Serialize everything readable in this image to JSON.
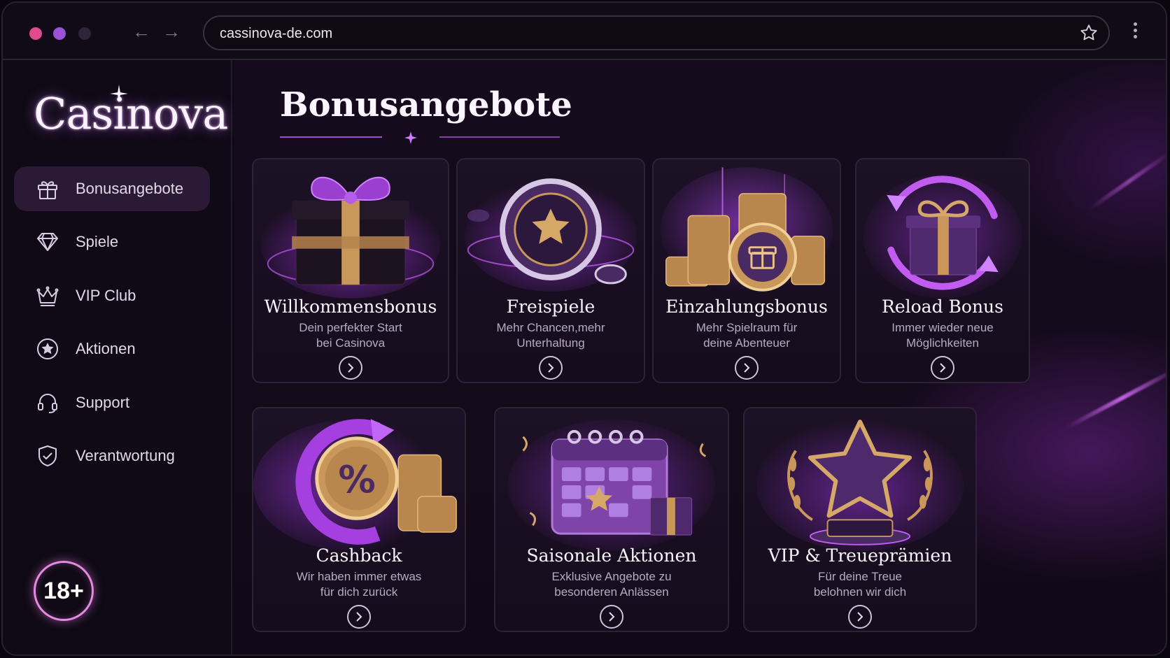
{
  "browser": {
    "url": "cassinova-de.com"
  },
  "sidebar": {
    "logo": "Casinova",
    "items": [
      {
        "label": "Bonusangebote",
        "icon": "gift-icon",
        "active": true
      },
      {
        "label": "Spiele",
        "icon": "diamond-icon",
        "active": false
      },
      {
        "label": "VIP Club",
        "icon": "crown-icon",
        "active": false
      },
      {
        "label": "Aktionen",
        "icon": "star-circle-icon",
        "active": false
      },
      {
        "label": "Support",
        "icon": "headset-icon",
        "active": false
      },
      {
        "label": "Verantwortung",
        "icon": "shield-check-icon",
        "active": false
      }
    ],
    "age_badge": "18+"
  },
  "main": {
    "title": "Bonusangebote",
    "cards": [
      {
        "title": "Willkommensbonus",
        "desc1": "Dein perfekter Start",
        "desc2": "bei Casinova",
        "icon": "gift-box-icon"
      },
      {
        "title": "Freispiele",
        "desc1": "Mehr Chancen,mehr",
        "desc2": "Unterhaltung",
        "icon": "casino-chip-icon"
      },
      {
        "title": "Einzahlungsbonus",
        "desc1": "Mehr Spielraum für",
        "desc2": "deine Abenteuer",
        "icon": "coin-stack-icon"
      },
      {
        "title": "Reload Bonus",
        "desc1": "Immer wieder neue",
        "desc2": "Möglichkeiten",
        "icon": "reload-gift-icon"
      },
      {
        "title": "Cashback",
        "desc1": "Wir haben immer etwas",
        "desc2": "für dich zurück",
        "icon": "percent-coin-icon"
      },
      {
        "title": "Saisonale Aktionen",
        "desc1": "Exklusive Angebote zu",
        "desc2": "besonderen Anlässen",
        "icon": "calendar-icon"
      },
      {
        "title": "VIP & Treueprämien",
        "desc1": "Für deine Treue",
        "desc2": "belohnen wir dich",
        "icon": "star-trophy-icon"
      }
    ]
  },
  "colors": {
    "accent": "#b44fe0",
    "gold": "#c9975a",
    "background": "#0d0814",
    "card": "#1d1126"
  }
}
